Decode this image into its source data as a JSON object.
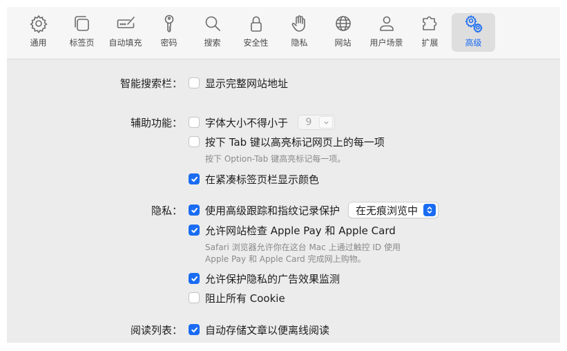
{
  "toolbar": {
    "tabs": [
      {
        "label": "通用",
        "icon": "gear-icon"
      },
      {
        "label": "标签页",
        "icon": "tabs-icon"
      },
      {
        "label": "自动填充",
        "icon": "autofill-icon"
      },
      {
        "label": "密码",
        "icon": "key-icon"
      },
      {
        "label": "搜索",
        "icon": "search-icon"
      },
      {
        "label": "安全性",
        "icon": "lock-icon"
      },
      {
        "label": "隐私",
        "icon": "hand-icon"
      },
      {
        "label": "网站",
        "icon": "globe-icon"
      },
      {
        "label": "用户场景",
        "icon": "person-icon"
      },
      {
        "label": "扩展",
        "icon": "puzzle-icon"
      },
      {
        "label": "高级",
        "icon": "gears-icon",
        "active": true
      }
    ]
  },
  "smart_search": {
    "label": "智能搜索栏：",
    "show_full_address": {
      "label": "显示完整网站地址",
      "checked": false
    }
  },
  "accessibility": {
    "label": "辅助功能：",
    "min_font": {
      "label": "字体大小不得小于",
      "checked": false,
      "value": "9"
    },
    "tab_highlight": {
      "label": "按下 Tab 键以高亮标记网页上的每一项",
      "checked": false
    },
    "tab_note": "按下 Option-Tab 键高亮标记每一项。",
    "compact_color": {
      "label": "在紧凑标签页栏显示颜色",
      "checked": true
    }
  },
  "privacy": {
    "label": "隐私：",
    "advanced_tracking": {
      "label": "使用高级跟踪和指纹记录保护",
      "checked": true,
      "option": "在无痕浏览中"
    },
    "apple_pay": {
      "label": "允许网站检查 Apple Pay 和 Apple Card",
      "checked": true
    },
    "apple_pay_note_1": "Safari 浏览器允许你在这台 Mac 上通过触控 ID 使用",
    "apple_pay_note_2": "Apple Pay 和 Apple Card 完成网上购物。",
    "ad_measurement": {
      "label": "允许保护隐私的广告效果监测",
      "checked": true
    },
    "block_cookies": {
      "label": "阻止所有 Cookie",
      "checked": false
    }
  },
  "reading_list": {
    "label": "阅读列表：",
    "save_offline": {
      "label": "自动存储文章以便离线阅读",
      "checked": true
    }
  },
  "colors": {
    "accent": "#1a6cf2",
    "background": "#ececec"
  }
}
